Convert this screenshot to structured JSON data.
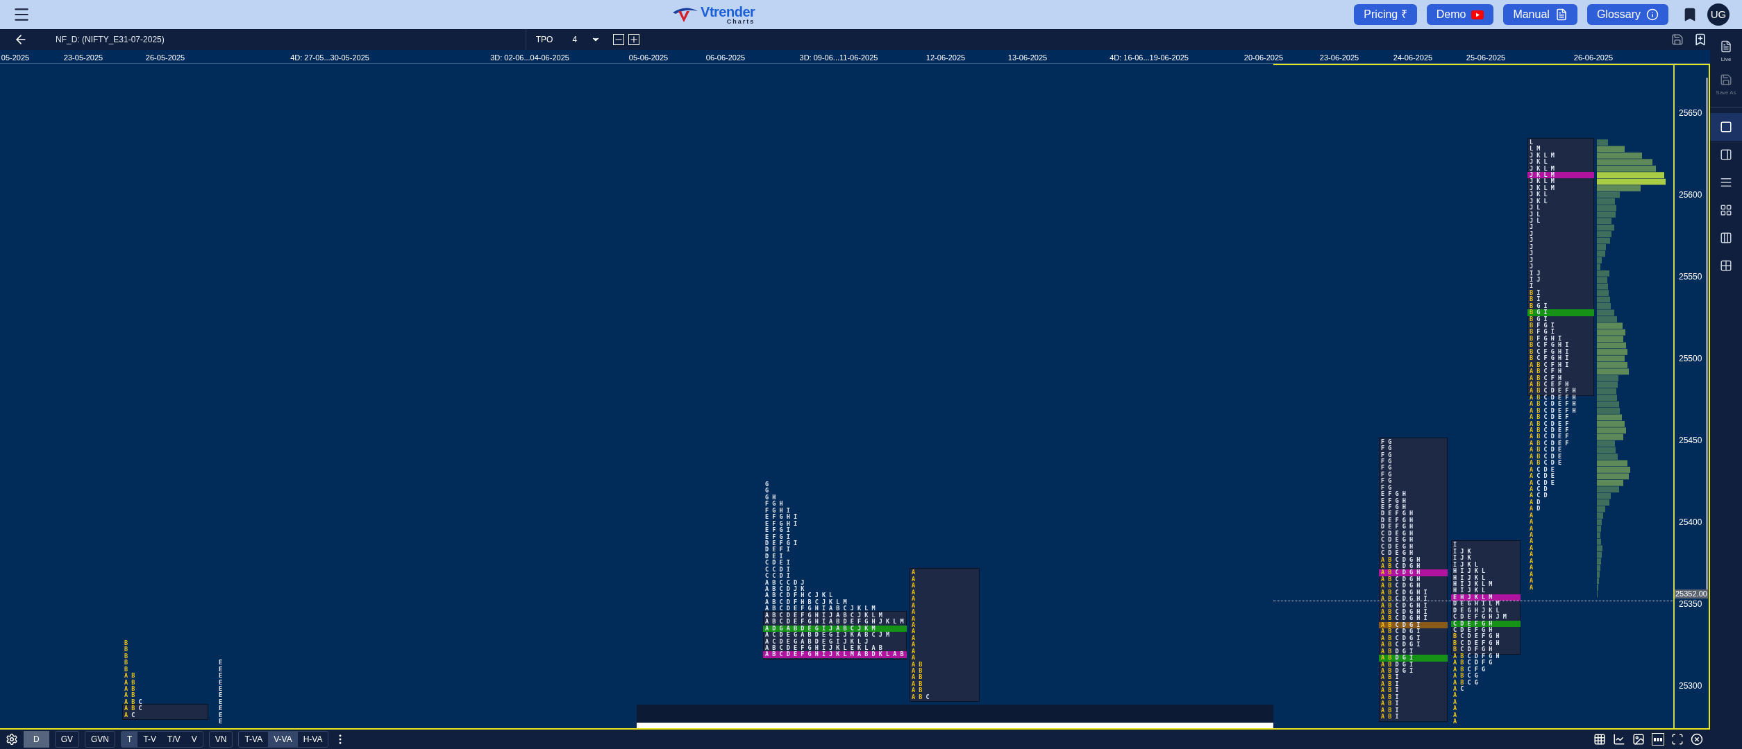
{
  "header": {
    "logo": {
      "name": "Vtrender",
      "tagline": "Charts"
    },
    "buttons": [
      {
        "kind": "pricing",
        "label": "Pricing ₹"
      },
      {
        "kind": "demo",
        "label": "Demo"
      },
      {
        "kind": "manual",
        "label": "Manual"
      },
      {
        "kind": "glossary",
        "label": "Glossary"
      }
    ],
    "avatar": "UG"
  },
  "toolbar": {
    "symbol": "NF_D: (NIFTY_E31-07-2025)",
    "mode_label": "TPO",
    "mode_value": "4"
  },
  "date_axis": [
    "05-2025",
    "23-05-2025",
    "26-05-2025",
    "4D: 27-05...30-05-2025",
    "3D: 02-06...04-06-2025",
    "05-06-2025",
    "06-06-2025",
    "3D: 09-06...11-06-2025",
    "12-06-2025",
    "13-06-2025",
    "4D: 16-06...19-06-2025",
    "20-06-2025",
    "23-06-2025",
    "24-06-2025",
    "25-06-2025",
    "26-06-2025"
  ],
  "price_axis": [
    "25650",
    "25600",
    "25550",
    "25500",
    "25450",
    "25400",
    "25350",
    "25300"
  ],
  "last_price": "25352.00",
  "profiles": [
    {
      "rows": [
        {
          "tpo": "**B**"
        },
        {
          "tpo": "**B**"
        },
        {
          "tpo": "**B**"
        },
        {
          "tpo": "**B**"
        },
        {
          "tpo": "**B**"
        },
        {
          "tpo": "**A** **B**"
        },
        {
          "tpo": "**A** **B**"
        },
        {
          "tpo": "**A** **B**"
        },
        {
          "tpo": "**A** **B**"
        },
        {
          "tpo": "**A** **B** C"
        },
        {
          "tpo": "**A** **B** C"
        },
        {
          "tpo": "**A** C"
        }
      ]
    },
    {
      "rows": [
        {
          "tpo": "E"
        },
        {
          "tpo": "E"
        },
        {
          "tpo": "E"
        },
        {
          "tpo": "E"
        },
        {
          "tpo": "E"
        },
        {
          "tpo": "E"
        },
        {
          "tpo": "E"
        },
        {
          "tpo": "E"
        },
        {
          "tpo": "E"
        },
        {
          "tpo": "E"
        }
      ]
    },
    {
      "rows": [
        {
          "tpo": "G"
        },
        {
          "tpo": "G"
        },
        {
          "tpo": "G H"
        },
        {
          "tpo": "F G H"
        },
        {
          "tpo": "F G H I"
        },
        {
          "tpo": "E F G H I"
        },
        {
          "tpo": "E F G H I"
        },
        {
          "tpo": "E F G I"
        },
        {
          "tpo": "E F G I"
        },
        {
          "tpo": "D E F G I"
        },
        {
          "tpo": "D E F I"
        },
        {
          "tpo": "D E I"
        },
        {
          "tpo": "C D E I"
        },
        {
          "tpo": "C C D I"
        },
        {
          "tpo": "C C D I"
        },
        {
          "tpo": "A B C C D J"
        },
        {
          "tpo": "A B C D J K"
        },
        {
          "tpo": "A B C D F H C J K L"
        },
        {
          "tpo": "A B C D F H B C J K L M"
        },
        {
          "tpo": "A B C D E F G H I A B C J K L M"
        },
        {
          "tpo": "A B C D E F G H I J A B C J K L M"
        },
        {
          "tpo": "A B C D E F G H I A B D E F G H J K L M"
        },
        {
          "tpo": "A D G A B D E G I J A B C J K M",
          "color": "#169216"
        },
        {
          "tpo": "A C D E G A B D E G I J K A B C J M"
        },
        {
          "tpo": "A C D E G A B D E G I J K L J"
        },
        {
          "tpo": "A B C D E F G H I J K L E K L A B"
        },
        {
          "tpo": "A B C D E F G H I J K L M A B D K L A B",
          "color": "#b0139e"
        }
      ]
    },
    {
      "rows": [
        {
          "tpo": "**A**"
        },
        {
          "tpo": "**A**"
        },
        {
          "tpo": "**A**"
        },
        {
          "tpo": "**A**"
        },
        {
          "tpo": "**A**"
        },
        {
          "tpo": "**A**"
        },
        {
          "tpo": "**A**"
        },
        {
          "tpo": "**A**"
        },
        {
          "tpo": "**A**"
        },
        {
          "tpo": "**A**"
        },
        {
          "tpo": "**A**"
        },
        {
          "tpo": "**A**"
        },
        {
          "tpo": "**A**"
        },
        {
          "tpo": "**A**"
        },
        {
          "tpo": "**A** **B**"
        },
        {
          "tpo": "**A** **B**"
        },
        {
          "tpo": "**A** **B**"
        },
        {
          "tpo": "**A** **B**"
        },
        {
          "tpo": "**A** **B**"
        },
        {
          "tpo": "**A** **B** C"
        }
      ]
    },
    {
      "rows": [
        {
          "tpo": "F G"
        },
        {
          "tpo": "F G"
        },
        {
          "tpo": "F G"
        },
        {
          "tpo": "F G"
        },
        {
          "tpo": "F G"
        },
        {
          "tpo": "F G"
        },
        {
          "tpo": "F G"
        },
        {
          "tpo": "F G"
        },
        {
          "tpo": "E F G H"
        },
        {
          "tpo": "E F G H"
        },
        {
          "tpo": "E F G H"
        },
        {
          "tpo": "D E F G H"
        },
        {
          "tpo": "D E F G H"
        },
        {
          "tpo": "D E F G H"
        },
        {
          "tpo": "C D E G H"
        },
        {
          "tpo": "C D E G H"
        },
        {
          "tpo": "C D E G H"
        },
        {
          "tpo": "C D E G H"
        },
        {
          "tpo": "**A** **B** C D G H"
        },
        {
          "tpo": "**A** **B** C D G H"
        },
        {
          "tpo": "**A** **B** C D G H",
          "color": "#b0139e"
        },
        {
          "tpo": "**A** **B** C D G H"
        },
        {
          "tpo": "**A** **B** C D G H"
        },
        {
          "tpo": "**A** **B** C D G H I"
        },
        {
          "tpo": "**A** **B** C D G H I"
        },
        {
          "tpo": "**A** **B** C D G H I"
        },
        {
          "tpo": "**A** **B** C D G H I"
        },
        {
          "tpo": "**A** **B** C D G H I"
        },
        {
          "tpo": "**A** **B** C D G I",
          "color": "#8a5a18"
        },
        {
          "tpo": "**A** **B** C D G I"
        },
        {
          "tpo": "**A** **B** C D G I"
        },
        {
          "tpo": "**A** **B** C D G I"
        },
        {
          "tpo": "**A** **B** D G I"
        },
        {
          "tpo": "**A** **B** D G I",
          "color": "#169216"
        },
        {
          "tpo": "**A** **B** D G I"
        },
        {
          "tpo": "**A** **B** D G I"
        },
        {
          "tpo": "**A** **B** I"
        },
        {
          "tpo": "**A** **B** I"
        },
        {
          "tpo": "**A** **B** I"
        },
        {
          "tpo": "**A** **B** I"
        },
        {
          "tpo": "**A** **B** I"
        },
        {
          "tpo": "**A** **B** I"
        },
        {
          "tpo": "**A** **B** I"
        }
      ]
    },
    {
      "rows": [
        {
          "tpo": "I"
        },
        {
          "tpo": "I J K"
        },
        {
          "tpo": "I J K"
        },
        {
          "tpo": "I J K L"
        },
        {
          "tpo": "H I J K L"
        },
        {
          "tpo": "H I J K L"
        },
        {
          "tpo": "H I J K L M"
        },
        {
          "tpo": "H I J K L"
        },
        {
          "tpo": "E H J K L M",
          "color": "#b0139e"
        },
        {
          "tpo": "D E G H I L M"
        },
        {
          "tpo": "D E G H J K L"
        },
        {
          "tpo": "C D E F G H J M"
        },
        {
          "tpo": "C D E F G H",
          "color": "#169216"
        },
        {
          "tpo": "C D E F G H"
        },
        {
          "tpo": "**B** C D E F G H"
        },
        {
          "tpo": "**B** C D E F G H"
        },
        {
          "tpo": "**B** C D F G H"
        },
        {
          "tpo": "**A** **B** C D F G H"
        },
        {
          "tpo": "**A** **B** C D F G"
        },
        {
          "tpo": "**A** **B** C F G"
        },
        {
          "tpo": "**A** **B** C G"
        },
        {
          "tpo": "**A** **B** C G"
        },
        {
          "tpo": "**A** C"
        },
        {
          "tpo": "**A**"
        },
        {
          "tpo": "**A**"
        },
        {
          "tpo": "**A**"
        },
        {
          "tpo": "**A**"
        },
        {
          "tpo": "**A**"
        }
      ]
    },
    {
      "rows": [
        {
          "tpo": "L"
        },
        {
          "tpo": "L M"
        },
        {
          "tpo": "J K L M"
        },
        {
          "tpo": "J K L"
        },
        {
          "tpo": "J K L M"
        },
        {
          "tpo": "J K L M",
          "color": "#b0139e"
        },
        {
          "tpo": "J K L M"
        },
        {
          "tpo": "J K L M"
        },
        {
          "tpo": "J K L"
        },
        {
          "tpo": "J K L"
        },
        {
          "tpo": "J L"
        },
        {
          "tpo": "J L"
        },
        {
          "tpo": "J L"
        },
        {
          "tpo": "J"
        },
        {
          "tpo": "J"
        },
        {
          "tpo": "J"
        },
        {
          "tpo": "J"
        },
        {
          "tpo": "J"
        },
        {
          "tpo": "J"
        },
        {
          "tpo": "J"
        },
        {
          "tpo": "I J"
        },
        {
          "tpo": "I J"
        },
        {
          "tpo": "I"
        },
        {
          "tpo": "**B** I"
        },
        {
          "tpo": "**B** I"
        },
        {
          "tpo": "**B** G I"
        },
        {
          "tpo": "**B** G I",
          "color": "#169216"
        },
        {
          "tpo": "**B** G I"
        },
        {
          "tpo": "**B** F G I"
        },
        {
          "tpo": "**B** F G I"
        },
        {
          "tpo": "**B** F G H I"
        },
        {
          "tpo": "**B** C F G H I"
        },
        {
          "tpo": "**B** C F G H I"
        },
        {
          "tpo": "**B** C F G H I"
        },
        {
          "tpo": "**A** **B** C F H I"
        },
        {
          "tpo": "**A** **B** C F H"
        },
        {
          "tpo": "**A** **B** C F H"
        },
        {
          "tpo": "**A** **B** C E F H"
        },
        {
          "tpo": "**A** **B** C D E F H"
        },
        {
          "tpo": "**A** **B** C D E F H"
        },
        {
          "tpo": "**A** **B** C D E F H"
        },
        {
          "tpo": "**A** **B** C D E F H"
        },
        {
          "tpo": "**A** **B** C D E F"
        },
        {
          "tpo": "**A** **B** C D E F"
        },
        {
          "tpo": "**A** **B** C D E F"
        },
        {
          "tpo": "**A** **B** C D E F"
        },
        {
          "tpo": "**A** **B** C D E F"
        },
        {
          "tpo": "**A** **B** C D E"
        },
        {
          "tpo": "**A** **B** C D E"
        },
        {
          "tpo": "**A** **B** C D E"
        },
        {
          "tpo": "**A** C D E"
        },
        {
          "tpo": "**A** C D E"
        },
        {
          "tpo": "**A** C D E"
        },
        {
          "tpo": "**A** C D"
        },
        {
          "tpo": "**A** C D"
        },
        {
          "tpo": "**A** D"
        },
        {
          "tpo": "**A** D"
        },
        {
          "tpo": "**A**"
        },
        {
          "tpo": "**A**"
        },
        {
          "tpo": "**A**"
        },
        {
          "tpo": "**A**"
        },
        {
          "tpo": "**A**"
        },
        {
          "tpo": "**A**"
        },
        {
          "tpo": "**A**"
        },
        {
          "tpo": "**A**"
        },
        {
          "tpo": "**A**"
        },
        {
          "tpo": "**A**"
        },
        {
          "tpo": "**A**"
        },
        {
          "tpo": "**A**"
        }
      ]
    }
  ],
  "sidebar": {
    "tools": [
      {
        "kind": "live",
        "label": "Live",
        "disabled": false
      },
      {
        "kind": "save_as",
        "label": "Save As",
        "disabled": true
      }
    ],
    "views": [
      {
        "kind": "single",
        "selected": true
      },
      {
        "kind": "split",
        "selected": false
      },
      {
        "kind": "rows",
        "selected": false
      },
      {
        "kind": "quad",
        "selected": false
      },
      {
        "kind": "columns",
        "selected": false
      },
      {
        "kind": "tiles",
        "selected": false
      }
    ]
  },
  "bottom_bar": {
    "groups": [
      {
        "buttons": [
          {
            "label": "D",
            "selected": true
          }
        ]
      },
      {
        "buttons": [
          {
            "label": "GV",
            "selected": false
          }
        ]
      },
      {
        "buttons": [
          {
            "label": "GVN",
            "selected": false
          }
        ]
      },
      {
        "buttons": [
          {
            "label": "T",
            "selected": true
          },
          {
            "label": "T-V",
            "selected": false
          },
          {
            "label": "T/V",
            "selected": false
          },
          {
            "label": "V",
            "selected": false
          }
        ]
      },
      {
        "buttons": [
          {
            "label": "VN",
            "selected": false
          }
        ]
      },
      {
        "buttons": [
          {
            "label": "T-VA",
            "selected": false
          },
          {
            "label": "V-VA",
            "selected": true
          },
          {
            "label": "H-VA",
            "selected": false
          }
        ]
      }
    ],
    "tools": [
      {
        "kind": "grid"
      },
      {
        "kind": "line"
      },
      {
        "kind": "image"
      },
      {
        "kind": "abc"
      },
      {
        "kind": "focus"
      },
      {
        "kind": "close"
      }
    ]
  }
}
